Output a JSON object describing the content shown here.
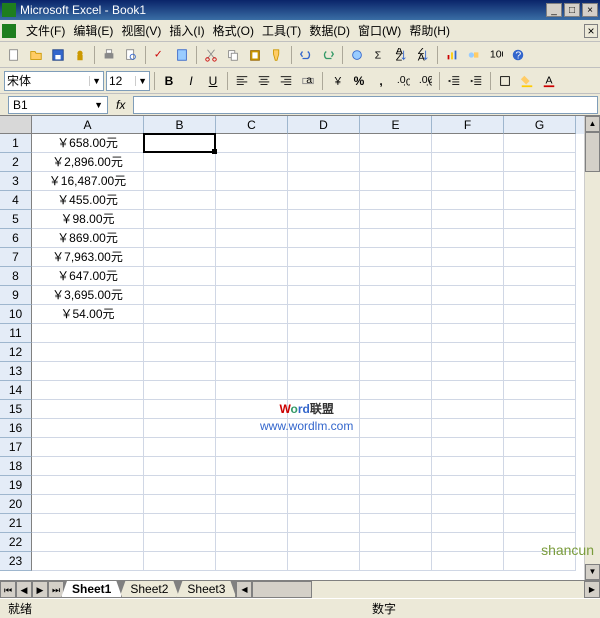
{
  "title": "Microsoft Excel - Book1",
  "menu": [
    "文件(F)",
    "编辑(E)",
    "视图(V)",
    "插入(I)",
    "格式(O)",
    "工具(T)",
    "数据(D)",
    "窗口(W)",
    "帮助(H)"
  ],
  "font": {
    "name": "宋体",
    "size": "12"
  },
  "namebox": "B1",
  "columns": [
    "A",
    "B",
    "C",
    "D",
    "E",
    "F",
    "G"
  ],
  "rows": [
    "1",
    "2",
    "3",
    "4",
    "5",
    "6",
    "7",
    "8",
    "9",
    "10",
    "11",
    "12",
    "13",
    "14",
    "15",
    "16",
    "17",
    "18",
    "19",
    "20",
    "21",
    "22",
    "23"
  ],
  "cellsA": [
    "￥658.00元",
    "￥2,896.00元",
    "￥16,487.00元",
    "￥455.00元",
    "￥98.00元",
    "￥869.00元",
    "￥7,963.00元",
    "￥647.00元",
    "￥3,695.00元",
    "￥54.00元",
    "",
    "",
    "",
    "",
    "",
    "",
    "",
    "",
    "",
    "",
    "",
    "",
    ""
  ],
  "sheets": [
    "Sheet1",
    "Sheet2",
    "Sheet3"
  ],
  "status": {
    "left": "就绪",
    "right": "数字"
  },
  "watermark": {
    "brand_a": "W",
    "brand_b": "o",
    "brand_c": "rd",
    "brand_d": "联盟",
    "url": "www.wordlm.com"
  },
  "logo": "shancun"
}
